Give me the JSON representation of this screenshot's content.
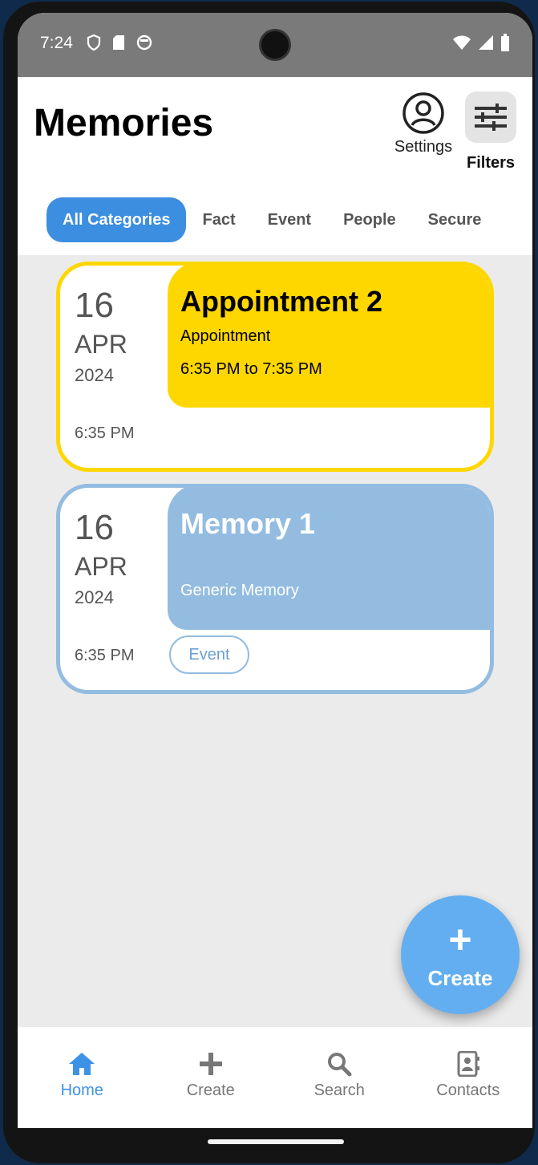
{
  "status_bar": {
    "time": "7:24"
  },
  "header": {
    "title": "Memories",
    "settings_label": "Settings",
    "filters_label": "Filters"
  },
  "tabs": [
    {
      "label": "All Categories",
      "active": true
    },
    {
      "label": "Fact",
      "active": false
    },
    {
      "label": "Event",
      "active": false
    },
    {
      "label": "People",
      "active": false
    },
    {
      "label": "Secure",
      "active": false
    }
  ],
  "cards": [
    {
      "day": "16",
      "month": "APR",
      "year": "2024",
      "time": "6:35 PM",
      "title": "Appointment 2",
      "type": "Appointment",
      "time_range": "6:35 PM to 7:35 PM",
      "color": "#ffd700"
    },
    {
      "day": "16",
      "month": "APR",
      "year": "2024",
      "time": "6:35 PM",
      "title": "Memory 1",
      "type": "Generic Memory",
      "tag": "Event",
      "color": "#93bce0"
    }
  ],
  "fab": {
    "icon": "plus-icon",
    "label": "Create"
  },
  "bottom_nav": [
    {
      "label": "Home",
      "icon": "home-icon",
      "active": true
    },
    {
      "label": "Create",
      "icon": "plus-icon",
      "active": false
    },
    {
      "label": "Search",
      "icon": "search-icon",
      "active": false
    },
    {
      "label": "Contacts",
      "icon": "contacts-icon",
      "active": false
    }
  ],
  "colors": {
    "accent": "#3b8ee0",
    "appointment": "#ffd700",
    "memory": "#93bce0"
  }
}
